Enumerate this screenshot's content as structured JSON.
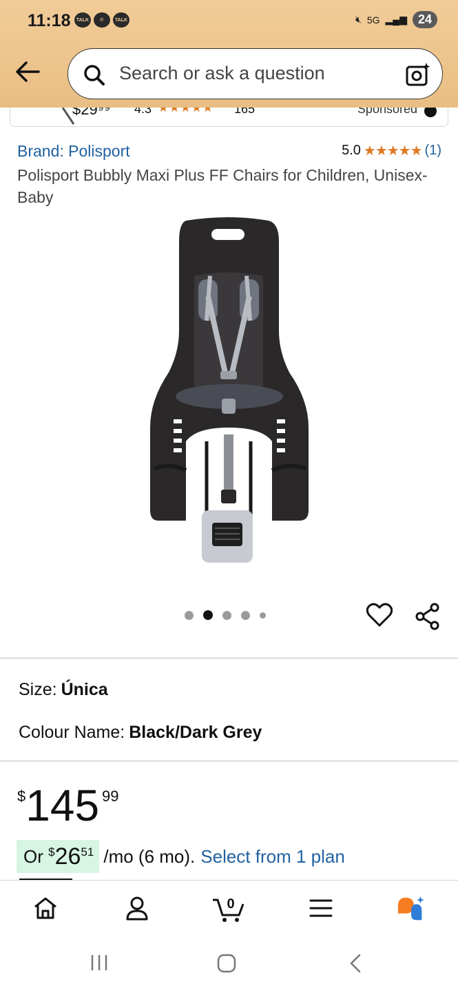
{
  "status_bar": {
    "time": "11:18",
    "left_icons": [
      "TALK",
      "whatsapp-icon",
      "TALK"
    ],
    "network": "5G",
    "battery": "24"
  },
  "search": {
    "placeholder": "Search or ask a question"
  },
  "sponsored_strip": {
    "price": "$29⁹⁹",
    "rating": "4.3",
    "stars": "★★★★★",
    "count": "165",
    "label": "Sponsored"
  },
  "product": {
    "brand": "Brand: Polisport",
    "rating_value": "5.0",
    "rating_stars": "★★★★★",
    "rating_count": "(1)",
    "title": "Polisport Bubbly Maxi Plus FF Chairs for Children, Unisex-Baby",
    "image_count": 5,
    "active_image": 2
  },
  "attributes": {
    "size_label": "Size:",
    "size_value": "Única",
    "colour_label": "Colour Name:",
    "colour_value": "Black/Dark Grey"
  },
  "price": {
    "currency": "$",
    "whole": "145",
    "fraction": "99"
  },
  "installment": {
    "prefix": "Or",
    "currency": "$",
    "whole": "26",
    "fraction": "51",
    "suffix": "/mo (6 mo).",
    "link": "Select from 1 plan",
    "highlight_color": "#d8f5e4"
  },
  "bottom_nav": {
    "items": [
      "home-icon",
      "account-icon",
      "cart-icon",
      "menu-icon",
      "rufus-icon"
    ],
    "cart_count": "0"
  },
  "colors": {
    "header": "#efc992",
    "link": "#2162a1",
    "star": "#de7921"
  }
}
